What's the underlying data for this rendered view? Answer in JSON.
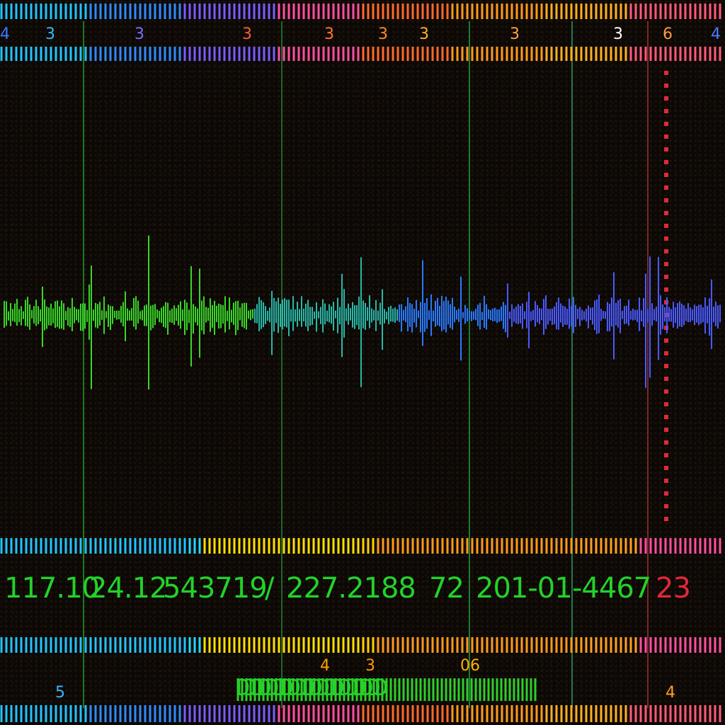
{
  "top_digits": [
    {
      "text": "4",
      "color": "#3a7bff"
    },
    {
      "text": "3",
      "color": "#35b6ff"
    },
    {
      "text": "3",
      "color": "#7a6bff"
    },
    {
      "text": "3",
      "color": "#ff5a3a"
    },
    {
      "text": "3",
      "color": "#ff7a2a"
    },
    {
      "text": "3",
      "color": "#ff8a2a"
    },
    {
      "text": "3",
      "color": "#ffb020"
    },
    {
      "text": "3",
      "color": "#ffa23a"
    },
    {
      "text": "3",
      "color": "#ffffff"
    },
    {
      "text": "6",
      "color": "#ff9a40"
    },
    {
      "text": "4",
      "color": "#4b7dff"
    }
  ],
  "readout": [
    {
      "text": "117.10",
      "color": "#22d22a"
    },
    {
      "text": "24.12",
      "color": "#22d22a"
    },
    {
      "text": "543719",
      "color": "#22d22a"
    },
    {
      "text": "/",
      "color": "#22d22a"
    },
    {
      "text": "227.2188",
      "color": "#22d22a"
    },
    {
      "text": "72",
      "color": "#22d22a"
    },
    {
      "text": "201-01",
      "color": "#22d22a"
    },
    {
      "text": "-4467",
      "color": "#22d22a"
    },
    {
      "text": "23",
      "color": "#e0283a"
    }
  ],
  "lower_digits": [
    {
      "text": "4",
      "color": "#ffa000"
    },
    {
      "text": "3",
      "color": "#ff9a00"
    },
    {
      "text": "06",
      "color": "#ffb000"
    }
  ],
  "bottom_left_digits": [
    {
      "text": "5",
      "color": "#3ab4ff"
    }
  ],
  "bottom_right_digits": [
    {
      "text": "4",
      "color": "#ffa020"
    }
  ],
  "bottom_code": {
    "text": "DDDDDDDDDDDDDDDDDDDD",
    "color": "#22d22a"
  }
}
